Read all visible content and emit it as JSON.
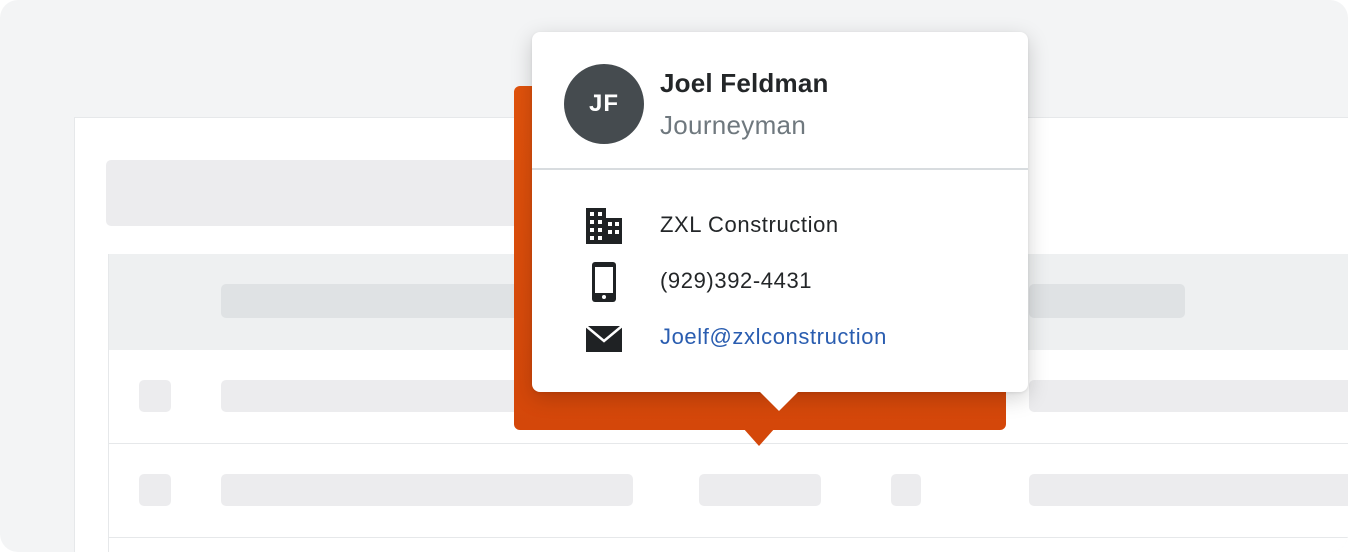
{
  "contact": {
    "initials": "JF",
    "name": "Joel Feldman",
    "role": "Journeyman",
    "company": "ZXL Construction",
    "phone": "(929)392-4431",
    "email": "Joelf@zxlconstruction"
  },
  "icons": {
    "company": "building-icon",
    "phone": "mobile-phone-icon",
    "email": "envelope-icon"
  },
  "colors": {
    "accent": "#d4470a",
    "avatar": "#454b4f",
    "link": "#2a5db0"
  }
}
